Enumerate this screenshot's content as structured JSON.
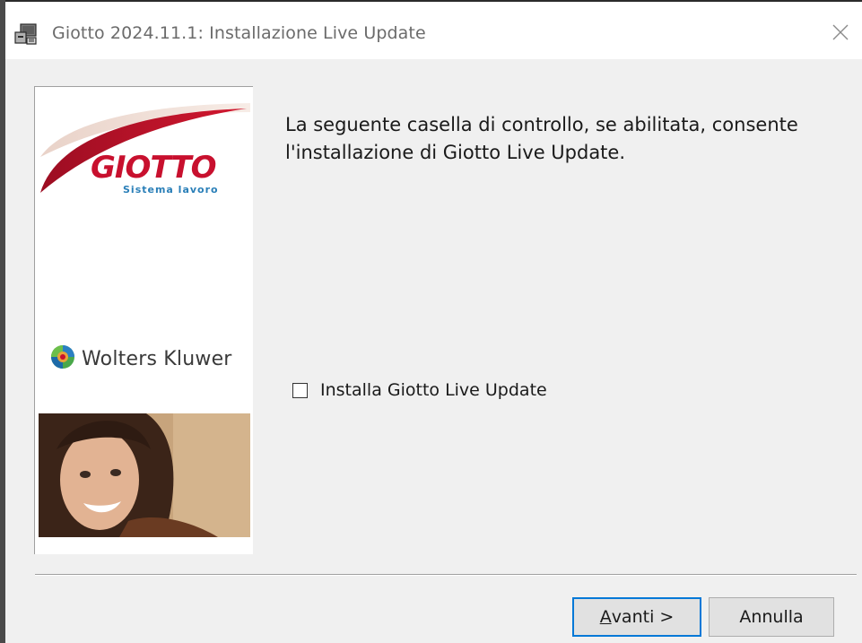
{
  "window": {
    "title": "Giotto 2024.11.1: Installazione Live Update",
    "icons": {
      "app": "installer-icon",
      "close": "close-icon"
    }
  },
  "sidebar": {
    "giotto_logo": {
      "brand": "GIOTTO",
      "tagline": "Sistema lavoro"
    },
    "publisher_logo": {
      "text": "Wolters Kluwer",
      "icon": "globe-icon"
    },
    "photo": "smiling-woman-photo"
  },
  "main": {
    "description": "La seguente casella di controllo, se abilitata, consente l'installazione di Giotto Live Update.",
    "checkbox": {
      "label": "Installa Giotto Live Update",
      "checked": false
    }
  },
  "footer": {
    "next": {
      "accel": "A",
      "rest": "vanti >"
    },
    "cancel_label": "Annulla"
  },
  "colors": {
    "brand_red": "#c8102e",
    "accent_blue": "#0078d7",
    "dialog_bg": "#f0f0f0"
  }
}
